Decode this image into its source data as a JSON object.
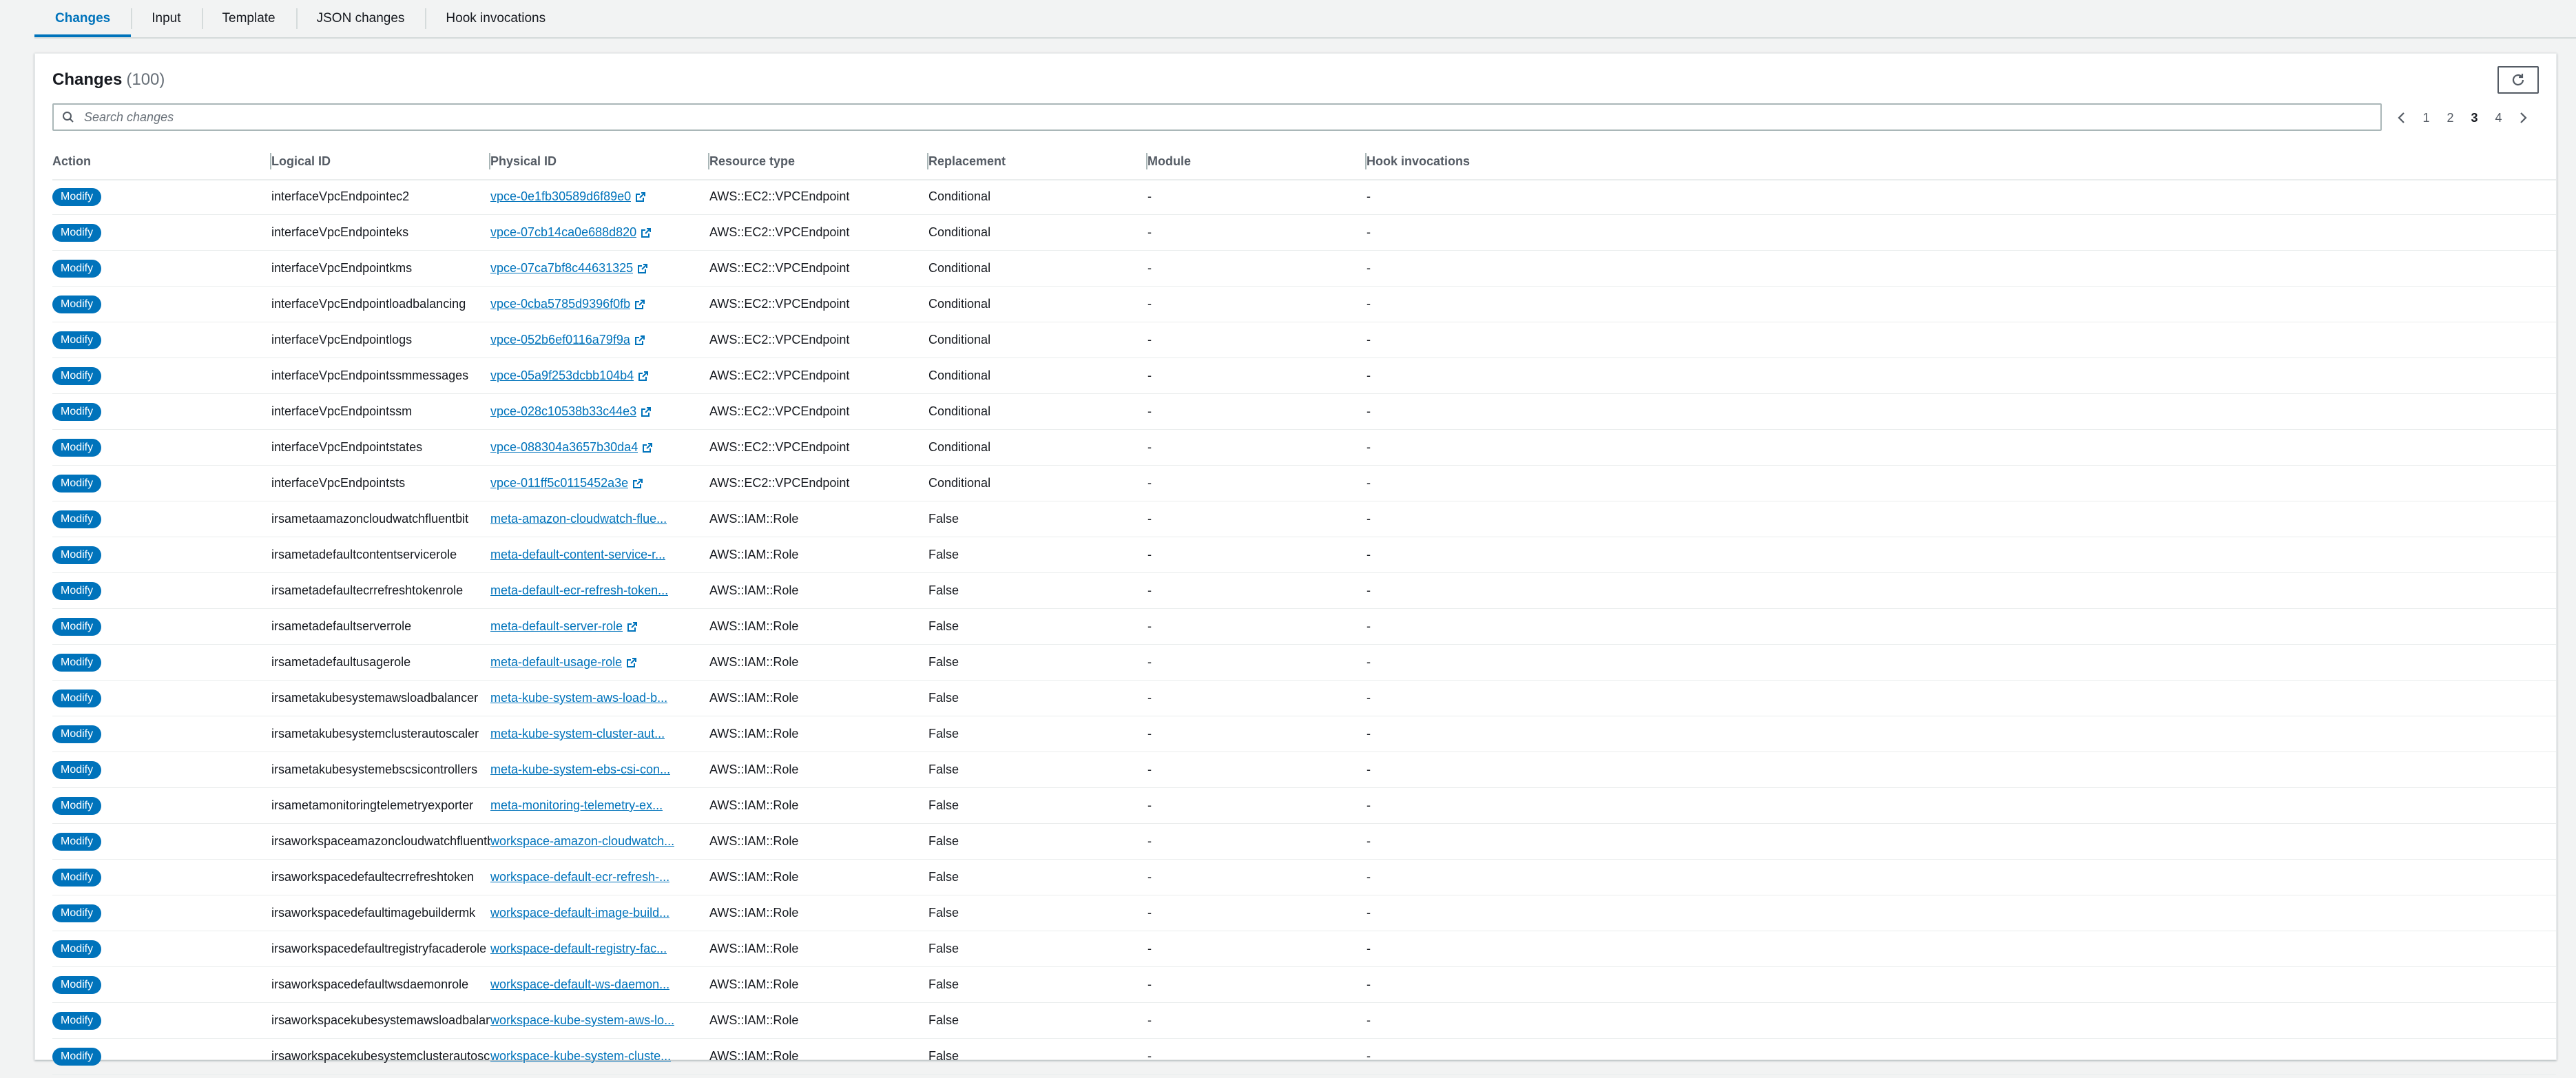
{
  "tabs": [
    {
      "label": "Changes",
      "active": true
    },
    {
      "label": "Input",
      "active": false
    },
    {
      "label": "Template",
      "active": false
    },
    {
      "label": "JSON changes",
      "active": false
    },
    {
      "label": "Hook invocations",
      "active": false
    }
  ],
  "panel": {
    "title": "Changes",
    "count": "(100)",
    "refresh_icon": "refresh-icon"
  },
  "search": {
    "placeholder": "Search changes",
    "icon": "search-icon"
  },
  "pagination": {
    "prev_icon": "chevron-left-icon",
    "next_icon": "chevron-right-icon",
    "pages": [
      "1",
      "2",
      "3",
      "4"
    ],
    "current": "3"
  },
  "columns": [
    "Action",
    "Logical ID",
    "Physical ID",
    "Resource type",
    "Replacement",
    "Module",
    "Hook invocations"
  ],
  "colors": {
    "accent": "#0073bb",
    "badge": "#0073bb",
    "text": "#16191f",
    "muted": "#545b64"
  },
  "rows": [
    {
      "action": "Modify",
      "logical_id": "interfaceVpcEndpointec2",
      "physical_id": "vpce-0e1fb30589d6f89e0",
      "resource_type": "AWS::EC2::VPCEndpoint",
      "replacement": "Conditional",
      "module": "-",
      "hook": "-"
    },
    {
      "action": "Modify",
      "logical_id": "interfaceVpcEndpointeks",
      "physical_id": "vpce-07cb14ca0e688d820",
      "resource_type": "AWS::EC2::VPCEndpoint",
      "replacement": "Conditional",
      "module": "-",
      "hook": "-"
    },
    {
      "action": "Modify",
      "logical_id": "interfaceVpcEndpointkms",
      "physical_id": "vpce-07ca7bf8c44631325",
      "resource_type": "AWS::EC2::VPCEndpoint",
      "replacement": "Conditional",
      "module": "-",
      "hook": "-"
    },
    {
      "action": "Modify",
      "logical_id": "interfaceVpcEndpointloadbalancing",
      "physical_id": "vpce-0cba5785d9396f0fb",
      "resource_type": "AWS::EC2::VPCEndpoint",
      "replacement": "Conditional",
      "module": "-",
      "hook": "-"
    },
    {
      "action": "Modify",
      "logical_id": "interfaceVpcEndpointlogs",
      "physical_id": "vpce-052b6ef0116a79f9a",
      "resource_type": "AWS::EC2::VPCEndpoint",
      "replacement": "Conditional",
      "module": "-",
      "hook": "-"
    },
    {
      "action": "Modify",
      "logical_id": "interfaceVpcEndpointssmmessages",
      "physical_id": "vpce-05a9f253dcbb104b4",
      "resource_type": "AWS::EC2::VPCEndpoint",
      "replacement": "Conditional",
      "module": "-",
      "hook": "-"
    },
    {
      "action": "Modify",
      "logical_id": "interfaceVpcEndpointssm",
      "physical_id": "vpce-028c10538b33c44e3",
      "resource_type": "AWS::EC2::VPCEndpoint",
      "replacement": "Conditional",
      "module": "-",
      "hook": "-"
    },
    {
      "action": "Modify",
      "logical_id": "interfaceVpcEndpointstates",
      "physical_id": "vpce-088304a3657b30da4",
      "resource_type": "AWS::EC2::VPCEndpoint",
      "replacement": "Conditional",
      "module": "-",
      "hook": "-"
    },
    {
      "action": "Modify",
      "logical_id": "interfaceVpcEndpointsts",
      "physical_id": "vpce-011ff5c0115452a3e",
      "resource_type": "AWS::EC2::VPCEndpoint",
      "replacement": "Conditional",
      "module": "-",
      "hook": "-"
    },
    {
      "action": "Modify",
      "logical_id": "irsametaamazoncloudwatchfluentbit",
      "physical_id": "meta-amazon-cloudwatch-flue...",
      "resource_type": "AWS::IAM::Role",
      "replacement": "False",
      "module": "-",
      "hook": "-"
    },
    {
      "action": "Modify",
      "logical_id": "irsametadefaultcontentservicerole",
      "physical_id": "meta-default-content-service-r...",
      "resource_type": "AWS::IAM::Role",
      "replacement": "False",
      "module": "-",
      "hook": "-"
    },
    {
      "action": "Modify",
      "logical_id": "irsametadefaultecrrefreshtokenrole",
      "physical_id": "meta-default-ecr-refresh-token...",
      "resource_type": "AWS::IAM::Role",
      "replacement": "False",
      "module": "-",
      "hook": "-"
    },
    {
      "action": "Modify",
      "logical_id": "irsametadefaultserverrole",
      "physical_id": "meta-default-server-role",
      "resource_type": "AWS::IAM::Role",
      "replacement": "False",
      "module": "-",
      "hook": "-"
    },
    {
      "action": "Modify",
      "logical_id": "irsametadefaultusagerole",
      "physical_id": "meta-default-usage-role",
      "resource_type": "AWS::IAM::Role",
      "replacement": "False",
      "module": "-",
      "hook": "-"
    },
    {
      "action": "Modify",
      "logical_id": "irsametakubesystemawsloadbalancer",
      "physical_id": "meta-kube-system-aws-load-b...",
      "resource_type": "AWS::IAM::Role",
      "replacement": "False",
      "module": "-",
      "hook": "-"
    },
    {
      "action": "Modify",
      "logical_id": "irsametakubesystemclusterautoscaler",
      "physical_id": "meta-kube-system-cluster-aut...",
      "resource_type": "AWS::IAM::Role",
      "replacement": "False",
      "module": "-",
      "hook": "-"
    },
    {
      "action": "Modify",
      "logical_id": "irsametakubesystemebscsicontrollers",
      "physical_id": "meta-kube-system-ebs-csi-con...",
      "resource_type": "AWS::IAM::Role",
      "replacement": "False",
      "module": "-",
      "hook": "-"
    },
    {
      "action": "Modify",
      "logical_id": "irsametamonitoringtelemetryexporter",
      "physical_id": "meta-monitoring-telemetry-ex...",
      "resource_type": "AWS::IAM::Role",
      "replacement": "False",
      "module": "-",
      "hook": "-"
    },
    {
      "action": "Modify",
      "logical_id": "irsaworkspaceamazoncloudwatchfluentbit",
      "physical_id": "workspace-amazon-cloudwatch...",
      "resource_type": "AWS::IAM::Role",
      "replacement": "False",
      "module": "-",
      "hook": "-"
    },
    {
      "action": "Modify",
      "logical_id": "irsaworkspacedefaultecrrefreshtoken",
      "physical_id": "workspace-default-ecr-refresh-...",
      "resource_type": "AWS::IAM::Role",
      "replacement": "False",
      "module": "-",
      "hook": "-"
    },
    {
      "action": "Modify",
      "logical_id": "irsaworkspacedefaultimagebuildermk",
      "physical_id": "workspace-default-image-build...",
      "resource_type": "AWS::IAM::Role",
      "replacement": "False",
      "module": "-",
      "hook": "-"
    },
    {
      "action": "Modify",
      "logical_id": "irsaworkspacedefaultregistryfacaderole",
      "physical_id": "workspace-default-registry-fac...",
      "resource_type": "AWS::IAM::Role",
      "replacement": "False",
      "module": "-",
      "hook": "-"
    },
    {
      "action": "Modify",
      "logical_id": "irsaworkspacedefaultwsdaemonrole",
      "physical_id": "workspace-default-ws-daemon...",
      "resource_type": "AWS::IAM::Role",
      "replacement": "False",
      "module": "-",
      "hook": "-"
    },
    {
      "action": "Modify",
      "logical_id": "irsaworkspacekubesystemawsloadbalancer",
      "physical_id": "workspace-kube-system-aws-lo...",
      "resource_type": "AWS::IAM::Role",
      "replacement": "False",
      "module": "-",
      "hook": "-"
    },
    {
      "action": "Modify",
      "logical_id": "irsaworkspacekubesystemclusterautoscaler",
      "physical_id": "workspace-kube-system-cluste...",
      "resource_type": "AWS::IAM::Role",
      "replacement": "False",
      "module": "-",
      "hook": "-"
    }
  ]
}
